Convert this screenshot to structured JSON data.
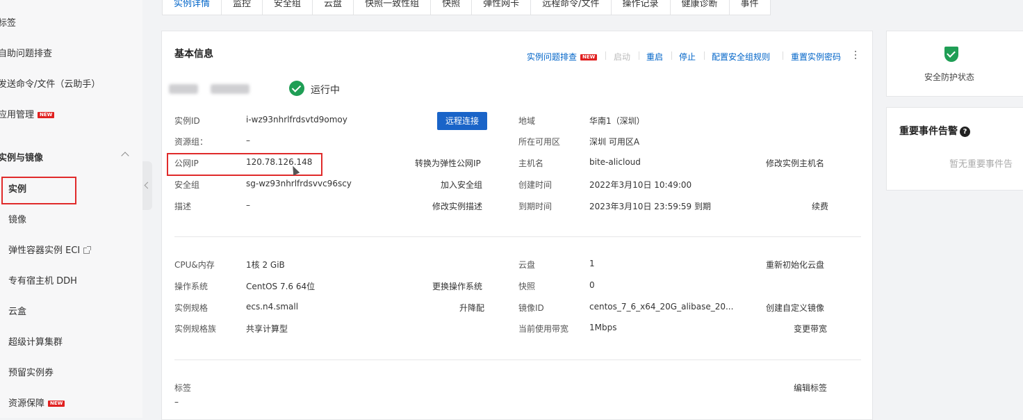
{
  "sidebar": {
    "items": [
      {
        "label": "标签"
      },
      {
        "label": "自助问题排查"
      },
      {
        "label": "发送命令/文件（云助手）"
      },
      {
        "label": "应用管理",
        "badge": "NEW"
      }
    ],
    "group_title": "实例与镜像",
    "sub_items": [
      {
        "label": "实例"
      },
      {
        "label": "镜像"
      },
      {
        "label": "弹性容器实例 ECI"
      },
      {
        "label": "专有宿主机 DDH"
      },
      {
        "label": "云盒"
      },
      {
        "label": "超级计算集群"
      },
      {
        "label": "预留实例券"
      },
      {
        "label": "资源保障",
        "badge": "NEW"
      }
    ]
  },
  "tabs": [
    "实例详情",
    "监控",
    "安全组",
    "云盘",
    "快照一致性组",
    "快照",
    "弹性网卡",
    "远程命令/文件",
    "操作记录",
    "健康诊断",
    "事件"
  ],
  "basic": {
    "title": "基本信息",
    "actions": {
      "troubleshoot": "实例问题排查",
      "troubleshoot_badge": "NEW",
      "start": "启动",
      "restart": "重启",
      "stop": "停止",
      "sg_rules": "配置安全组规则",
      "reset_pwd": "重置实例密码"
    },
    "status": "运行中",
    "left": [
      {
        "label": "实例ID",
        "value": "i-wz93nhrlfrdsvtd9omoy"
      },
      {
        "label": "资源组：",
        "value": "–"
      },
      {
        "label": "公网IP",
        "value": "120.78.126.148",
        "action": "转换为弹性公网IP"
      },
      {
        "label": "安全组",
        "value": "sg-wz93nhrlfrdsvvc96scy",
        "action": "加入安全组"
      },
      {
        "label": "描述",
        "value": "–",
        "action": "修改实例描述"
      }
    ],
    "remote_btn": "远程连接",
    "right": [
      {
        "label": "地域",
        "value": "华南1（深圳）"
      },
      {
        "label": "所在可用区",
        "value": "深圳 可用区A"
      },
      {
        "label": "主机名",
        "value": "bite-alicloud",
        "action": "修改实例主机名"
      },
      {
        "label": "创建时间",
        "value": "2022年3月10日 10:49:00"
      },
      {
        "label": "到期时间",
        "value": "2023年3月10日 23:59:59 到期",
        "action": "续费"
      }
    ],
    "spec_left": [
      {
        "label": "CPU&内存",
        "value": "1核 2 GiB"
      },
      {
        "label": "操作系统",
        "value": "CentOS 7.6 64位",
        "action": "更换操作系统"
      },
      {
        "label": "实例规格",
        "value": "ecs.n4.small",
        "action": "升降配"
      },
      {
        "label": "实例规格族",
        "value": "共享计算型"
      }
    ],
    "spec_right": [
      {
        "label": "云盘",
        "value": "1",
        "action": "重新初始化云盘"
      },
      {
        "label": "快照",
        "value": "0"
      },
      {
        "label": "镜像ID",
        "value": "centos_7_6_x64_20G_alibase_20...",
        "action": "创建自定义镜像"
      },
      {
        "label": "当前使用带宽",
        "value": "1Mbps",
        "action": "变更带宽"
      }
    ],
    "tags": {
      "label": "标签",
      "value": "–",
      "action": "编辑标签"
    }
  },
  "security": {
    "label": "安全防护状态"
  },
  "events": {
    "title": "重要事件告警",
    "help": "?",
    "empty": "暂无重要事件告"
  }
}
